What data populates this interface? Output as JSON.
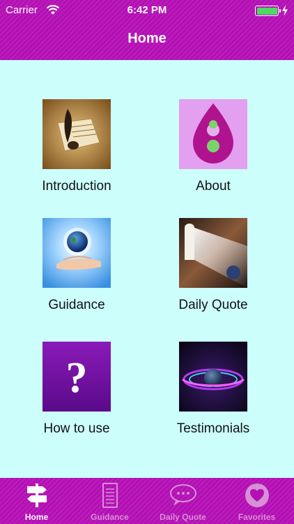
{
  "status_bar": {
    "carrier": "Carrier",
    "time": "6:42 PM"
  },
  "header": {
    "title": "Home"
  },
  "grid": [
    {
      "label": "Introduction",
      "icon": "quill-paper-icon"
    },
    {
      "label": "About",
      "icon": "purple-drop-icon"
    },
    {
      "label": "Guidance",
      "icon": "earth-in-hand-icon"
    },
    {
      "label": "Daily Quote",
      "icon": "light-door-icon"
    },
    {
      "label": "How to use",
      "icon": "question-mark-icon"
    },
    {
      "label": "Testimonials",
      "icon": "planet-ring-icon"
    }
  ],
  "tabs": [
    {
      "label": "Home",
      "icon": "signpost-icon",
      "active": true
    },
    {
      "label": "Guidance",
      "icon": "document-icon",
      "active": false
    },
    {
      "label": "Daily Quote",
      "icon": "speech-bubble-icon",
      "active": false
    },
    {
      "label": "Favorites",
      "icon": "heart-icon",
      "active": false
    }
  ],
  "colors": {
    "header_bg": "#b40fb4",
    "content_bg": "#ccfefc",
    "tab_inactive": "#d690d6",
    "tab_active": "#ffffff"
  }
}
